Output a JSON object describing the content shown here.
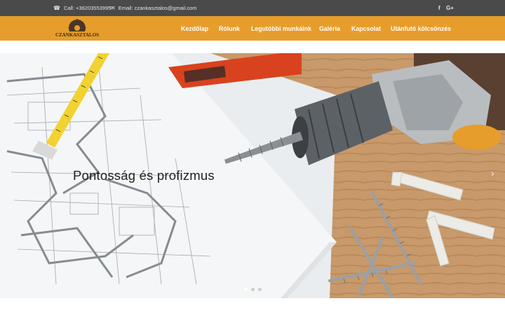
{
  "topbar": {
    "phone_text": "Call: +36203553995",
    "email_text": "Email: czankasztalos@gmail.com",
    "social": [
      "f",
      "G+"
    ]
  },
  "logo": {
    "text": "CZANKASZTALOS"
  },
  "nav": {
    "items": [
      {
        "label": "Kezdőlap",
        "active": true
      },
      {
        "label": "Rólunk"
      },
      {
        "label": "Legutóbbi munkáink"
      },
      {
        "label": "Galéria"
      },
      {
        "label": "Kapcsolat"
      },
      {
        "label": "Utánfutó kölcsönzés"
      }
    ]
  },
  "hero": {
    "caption": "Pontosság és profizmus",
    "prev_icon": "‹",
    "next_icon": "›",
    "slide_count": 3,
    "active_slide": 1
  },
  "colors": {
    "topbar_bg": "#4a4a4a",
    "accent": "#e79d2b",
    "nav_text": "#ffffff"
  }
}
